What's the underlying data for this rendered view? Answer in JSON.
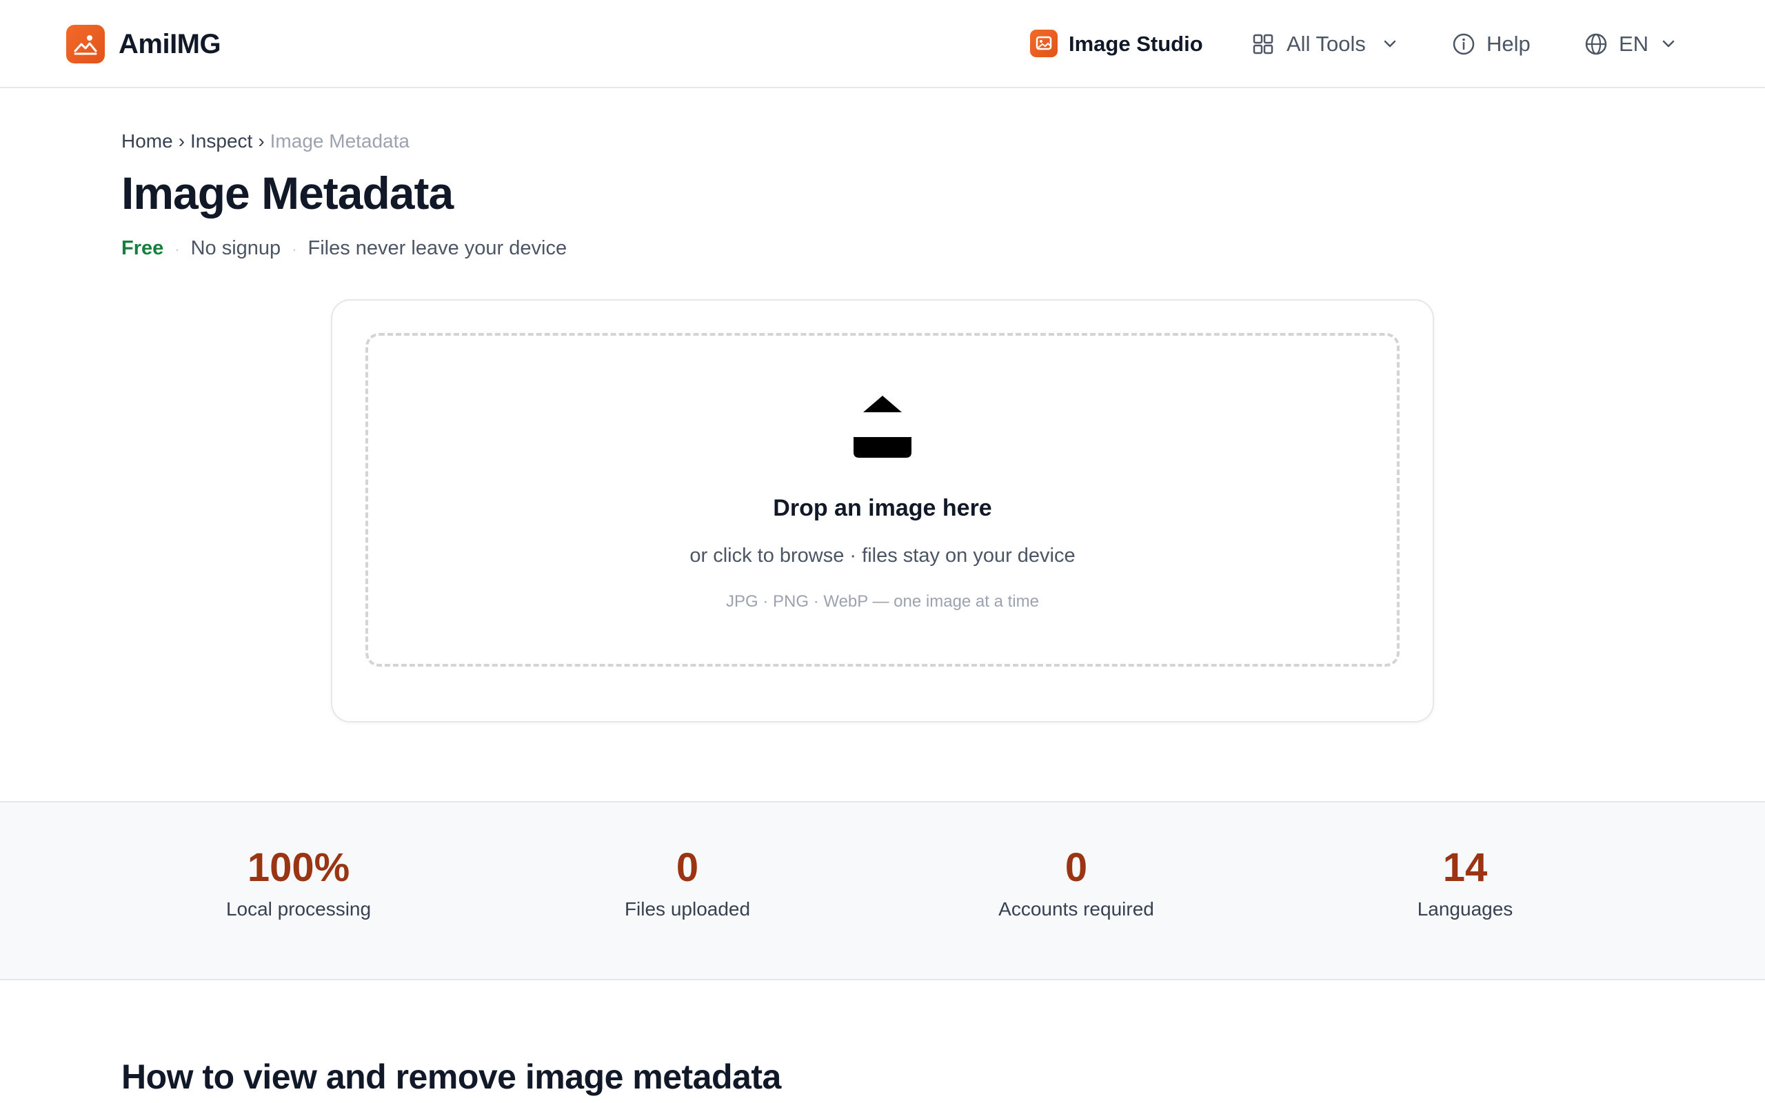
{
  "header": {
    "brand": "AmiIMG",
    "nav": {
      "studio_label": "Image Studio",
      "tools_label": "All Tools",
      "help_label": "Help",
      "lang_label": "EN"
    }
  },
  "breadcrumb": {
    "home": "Home",
    "inspect": "Inspect",
    "current": "Image Metadata",
    "separator": "›"
  },
  "page": {
    "title": "Image Metadata",
    "free": "Free",
    "no_signup": "No signup",
    "privacy": "Files never leave your device"
  },
  "upload": {
    "title": "Drop an image here",
    "subtitle": "or click to browse · files stay on your device",
    "formats": "JPG · PNG · WebP — one image at a time",
    "icon": "upload-icon"
  },
  "stats": [
    {
      "value": "100%",
      "label": "Local processing"
    },
    {
      "value": "0",
      "label": "Files uploaded"
    },
    {
      "value": "0",
      "label": "Accounts required"
    },
    {
      "value": "14",
      "label": "Languages"
    }
  ],
  "howto": {
    "heading": "How to view and remove image metadata"
  },
  "colors": {
    "accent": "#e85d1f",
    "free_green": "#15803d",
    "stat_value": "#9a3412"
  }
}
